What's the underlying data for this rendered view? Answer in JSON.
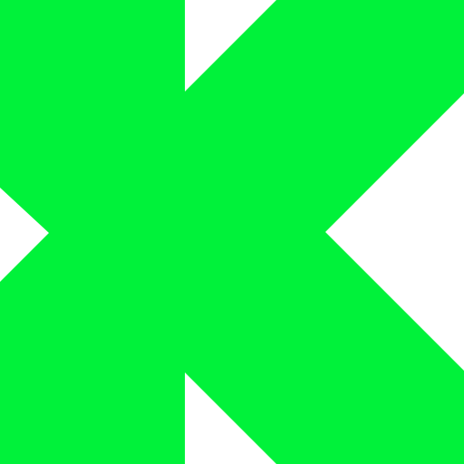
{
  "logo": {
    "name": "k-logo-mark",
    "fill_color": "#00F23A",
    "background_color": "#FFFFFF"
  }
}
